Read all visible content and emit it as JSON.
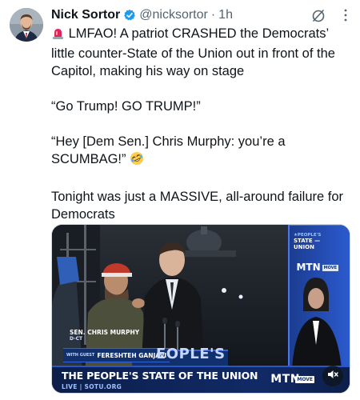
{
  "tweet": {
    "author": {
      "display_name": "Nick Sortor",
      "handle": "@nicksortor",
      "separator": "·",
      "time": "1h",
      "verified": true
    },
    "lines": [
      "LMFAO! A patriot CRASHED the Democrats’ little counter-State of the Union out in front of the Capitol, making his way on stage",
      "“Go Trump! GO TRUMP!”",
      "“Hey [Dem Sen.] Chris Murphy: you’re a SCUMBAG!”",
      "Tonight was just a MASSIVE, all-around failure for Democrats"
    ],
    "icons": {
      "leading_emoji": "police-siren",
      "trailing_emoji": "rolling-on-floor-laughing",
      "grok": "grok-icon",
      "more": "more-icon"
    }
  },
  "media": {
    "lower_third": {
      "senator_name": "SEN. CHRIS MURPHY",
      "senator_sub": "D-CT",
      "guest_prefix": "WITH GUEST",
      "guest_name": "FERESHTEH GANJAVI",
      "people_fragment": "EOPLE'S",
      "show_title": "THE PEOPLE'S STATE OF THE UNION",
      "show_sub": "LIVE | SOTU.ORG",
      "network": "MTN",
      "network_chip": "MOVE"
    },
    "backdrop": {
      "logo_small": "★PEOPLE'S",
      "logo_big": "STATE — UNION",
      "side_network": "MTN",
      "side_chip": "MOVE"
    },
    "colors": {
      "banner_blue": "#10306e",
      "accent_blue": "#2a56c8",
      "cap_red": "#c0392b"
    },
    "mute_state": "muted"
  }
}
